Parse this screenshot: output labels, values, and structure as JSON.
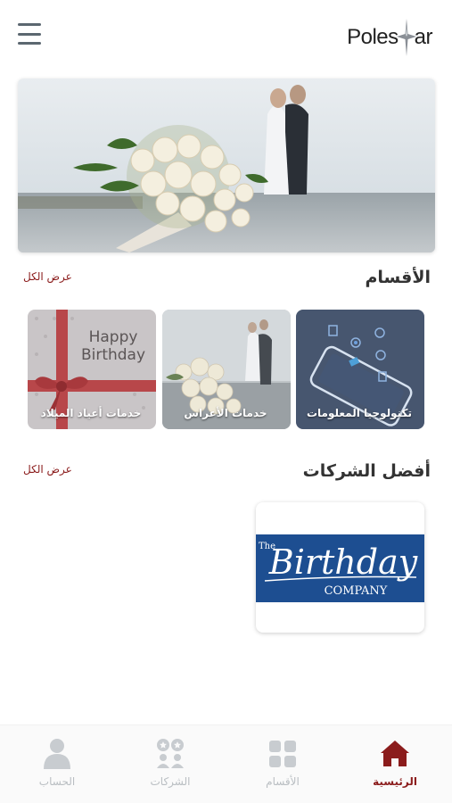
{
  "header": {
    "logo_text_left": "Poles",
    "logo_text_right": "ar"
  },
  "categories_section": {
    "title": "الأقسام",
    "view_all": "عرض الكل",
    "items": [
      {
        "label": "تكنولوجيا المعلومات"
      },
      {
        "label": "خدمات الأعراس"
      },
      {
        "label": "خدمات أعياد الميلاد",
        "image_text_line1": "Happy",
        "image_text_line2": "Birthday"
      }
    ]
  },
  "companies_section": {
    "title": "أفضل الشركات",
    "view_all": "عرض الكل",
    "items": [
      {
        "logo_small": "The",
        "logo_main": "Birthday",
        "logo_sub": "COMPANY"
      }
    ]
  },
  "bottom_nav": {
    "items": [
      {
        "label": "الرئيسية",
        "icon": "home-icon",
        "active": true
      },
      {
        "label": "الأقسام",
        "icon": "grid-icon",
        "active": false
      },
      {
        "label": "الشركات",
        "icon": "companies-icon",
        "active": false
      },
      {
        "label": "الحساب",
        "icon": "user-icon",
        "active": false
      }
    ]
  },
  "colors": {
    "accent": "#8b1c1c",
    "nav_inactive": "#c8ccd0",
    "company_blue": "#1d4e91"
  }
}
